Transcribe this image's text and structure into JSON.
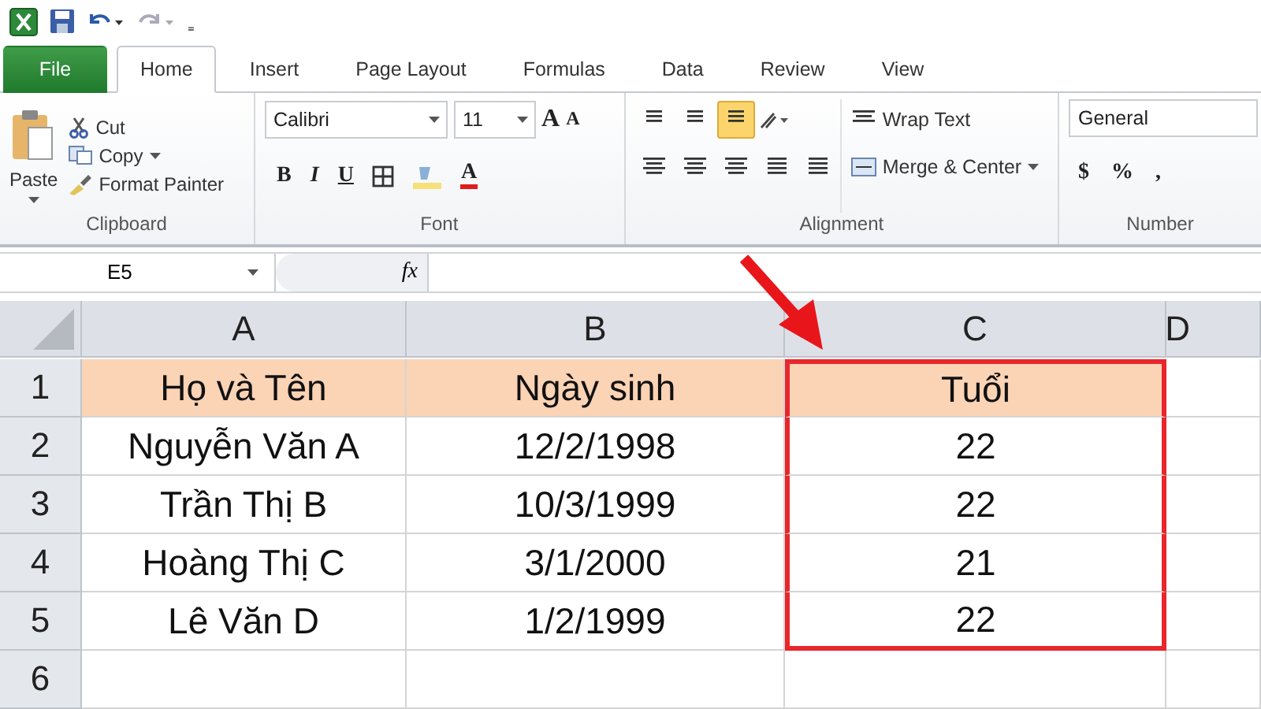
{
  "quick_access": {
    "customize": "₌"
  },
  "tabs": [
    {
      "label": "File",
      "kind": "file",
      "selected": false
    },
    {
      "label": "Home",
      "kind": "tab",
      "selected": true
    },
    {
      "label": "Insert",
      "kind": "tab",
      "selected": false
    },
    {
      "label": "Page Layout",
      "kind": "tab",
      "selected": false
    },
    {
      "label": "Formulas",
      "kind": "tab",
      "selected": false
    },
    {
      "label": "Data",
      "kind": "tab",
      "selected": false
    },
    {
      "label": "Review",
      "kind": "tab",
      "selected": false
    },
    {
      "label": "View",
      "kind": "tab",
      "selected": false
    }
  ],
  "clipboard": {
    "paste": "Paste",
    "cut": "Cut",
    "copy": "Copy",
    "format_painter": "Format Painter",
    "label": "Clipboard"
  },
  "font": {
    "font_name": "Calibri",
    "font_size": "11",
    "grow": "A",
    "shrink": "A",
    "bold": "B",
    "italic": "I",
    "underline": "U",
    "font_color": "A",
    "label": "Font"
  },
  "alignment": {
    "vertical": [
      {
        "selected": false
      },
      {
        "selected": false
      },
      {
        "selected": true
      }
    ],
    "wrap_text": "Wrap Text",
    "merge_center": "Merge & Center",
    "label": "Alignment"
  },
  "number": {
    "format": "General",
    "currency": "$",
    "percent": "%",
    "comma": ",",
    "label": "Number"
  },
  "formula_bar": {
    "name_box": "E5",
    "function_label": "fx"
  },
  "sheet": {
    "columns": [
      "A",
      "B",
      "C",
      "D"
    ],
    "rows": [
      {
        "number": "1",
        "header": true,
        "cells": [
          {
            "text": "Họ và Tên",
            "highlighted": false
          },
          {
            "text": "Ngày sinh",
            "highlighted": false
          },
          {
            "text": "Tuổi",
            "highlighted": true
          }
        ]
      },
      {
        "number": "2",
        "header": false,
        "cells": [
          {
            "text": "Nguyễn Văn A",
            "highlighted": false
          },
          {
            "text": "12/2/1998",
            "highlighted": false
          },
          {
            "text": "22",
            "highlighted": true
          }
        ]
      },
      {
        "number": "3",
        "header": false,
        "cells": [
          {
            "text": "Trần Thị B",
            "highlighted": false
          },
          {
            "text": "10/3/1999",
            "highlighted": false
          },
          {
            "text": "22",
            "highlighted": true
          }
        ]
      },
      {
        "number": "4",
        "header": false,
        "cells": [
          {
            "text": "Hoàng Thị C",
            "highlighted": false
          },
          {
            "text": "3/1/2000",
            "highlighted": false
          },
          {
            "text": "21",
            "highlighted": true
          }
        ]
      },
      {
        "number": "5",
        "header": false,
        "cells": [
          {
            "text": "Lê Văn D",
            "highlighted": false
          },
          {
            "text": "1/2/1999",
            "highlighted": false
          },
          {
            "text": "22",
            "highlighted": true
          }
        ]
      },
      {
        "number": "6",
        "header": false,
        "cells": [
          {
            "text": "",
            "highlighted": false
          },
          {
            "text": "",
            "highlighted": false
          },
          {
            "text": "",
            "highlighted": false
          }
        ]
      }
    ]
  }
}
